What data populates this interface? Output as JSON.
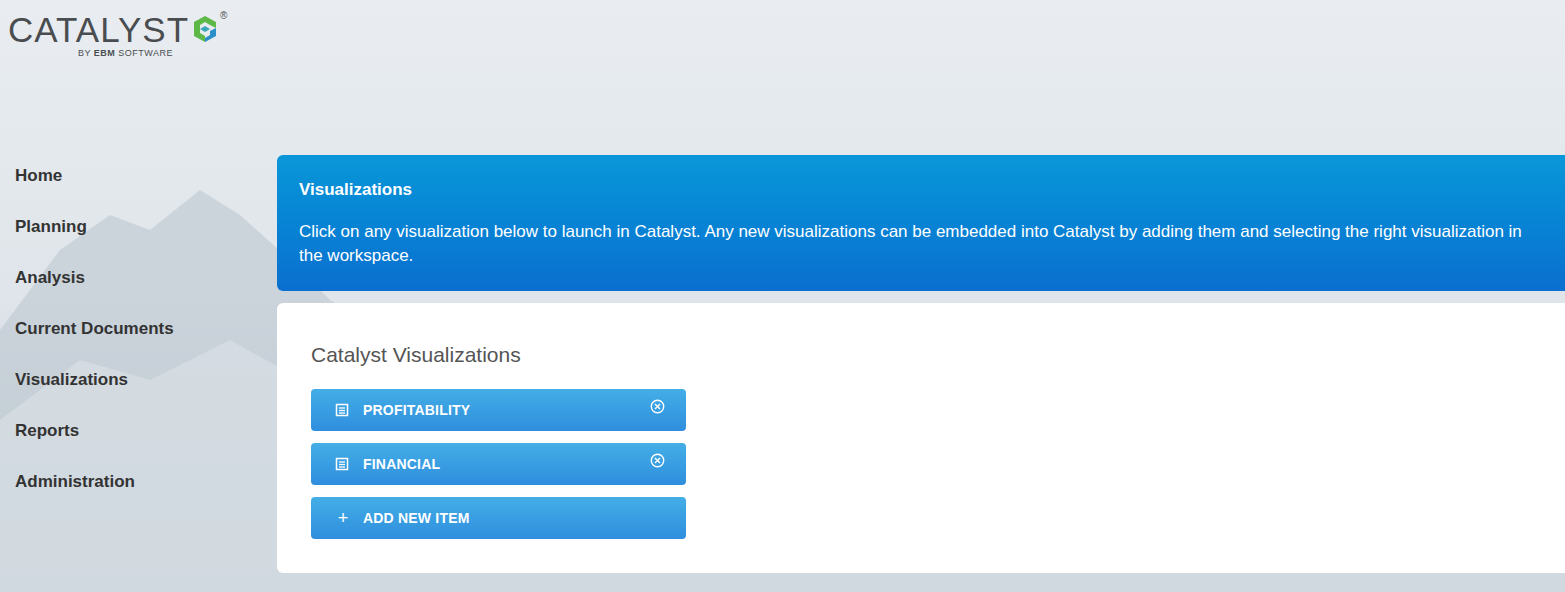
{
  "logo": {
    "name": "CATALYST",
    "registered": "®",
    "tagline": [
      {
        "text": "BY ",
        "bold": false
      },
      {
        "text": "EBM",
        "bold": true
      },
      {
        "text": " SOFTWARE",
        "bold": false
      }
    ]
  },
  "sidebar": {
    "items": [
      {
        "label": "Home",
        "selected": false
      },
      {
        "label": "Planning",
        "selected": false
      },
      {
        "label": "Analysis",
        "selected": false
      },
      {
        "label": "Current Documents",
        "selected": false
      },
      {
        "label": "Visualizations",
        "selected": false
      },
      {
        "label": "Reports",
        "selected": false
      },
      {
        "label": "Administration",
        "selected": false
      }
    ]
  },
  "banner": {
    "title": "Visualizations",
    "text": "Click on any visualization below to launch in Catalyst. Any new visualizations can be embedded into Catalyst by adding them and selecting the right visualization in the workspace."
  },
  "panel": {
    "title": "Catalyst Visualizations",
    "items": [
      {
        "label": "PROFITABILITY",
        "kind": "item"
      },
      {
        "label": "FINANCIAL",
        "kind": "item"
      },
      {
        "label": "ADD NEW ITEM",
        "kind": "add",
        "icon": "+"
      }
    ]
  }
}
